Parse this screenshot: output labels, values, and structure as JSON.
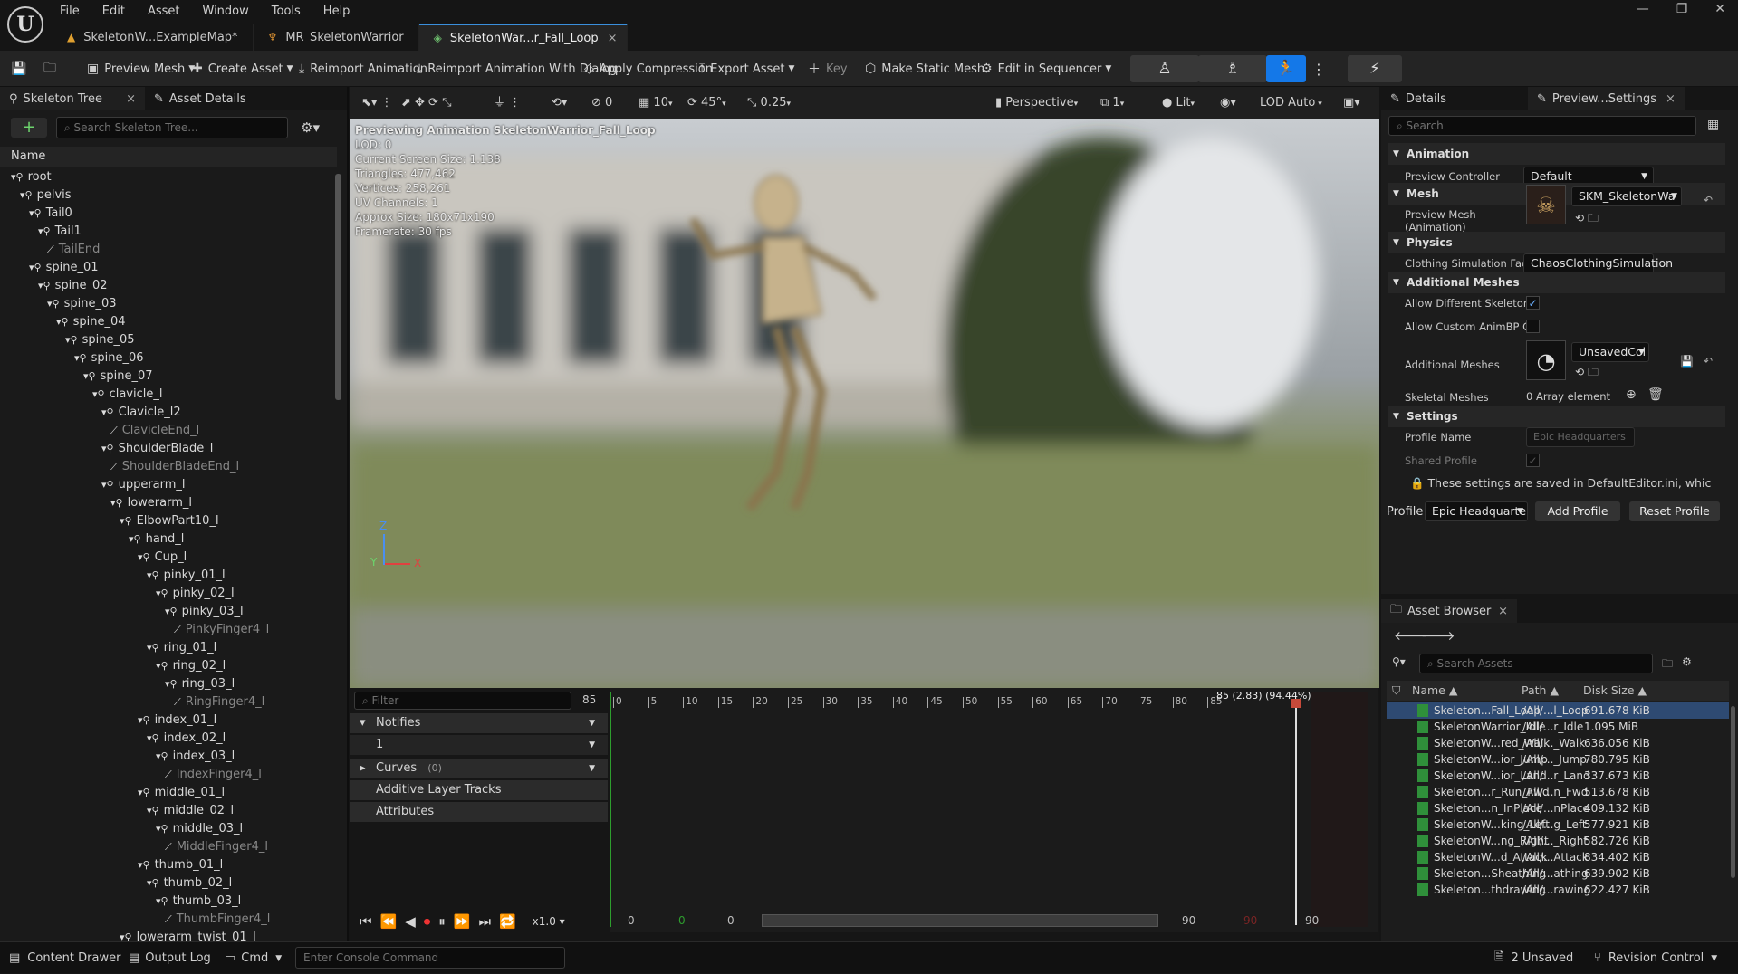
{
  "app": {
    "logo": "U"
  },
  "menu": [
    "File",
    "Edit",
    "Asset",
    "Window",
    "Tools",
    "Help"
  ],
  "doc_tabs": [
    {
      "label": "SkeletonW...ExampleMap*",
      "icon": "warning-icon"
    },
    {
      "label": "MR_SkeletonWarrior",
      "icon": "mesh-icon"
    },
    {
      "label": "SkeletonWar...r_Fall_Loop",
      "icon": "animation-icon",
      "close": "×"
    }
  ],
  "window_controls": [
    "—",
    "❐",
    "✕"
  ],
  "toolbar": {
    "preview_mesh": "Preview Mesh",
    "create_asset": "Create Asset",
    "reimport": "Reimport Animation",
    "reimport_dialog": "Reimport Animation With Dialog",
    "apply_compression": "Apply Compression",
    "export_asset": "Export Asset",
    "key": "Key",
    "make_static": "Make Static Mesh",
    "edit_sequencer": "Edit in Sequencer"
  },
  "skeleton_panel": {
    "tab": "Skeleton Tree",
    "tab2": "Asset Details",
    "close": "×",
    "search_placeholder": "Search Skeleton Tree...",
    "column": "Name",
    "add": "+",
    "bones": [
      {
        "n": "root",
        "d": 0
      },
      {
        "n": "pelvis",
        "d": 1
      },
      {
        "n": "Tail0",
        "d": 2
      },
      {
        "n": "Tail1",
        "d": 3
      },
      {
        "n": "TailEnd",
        "d": 4,
        "v": true
      },
      {
        "n": "spine_01",
        "d": 2
      },
      {
        "n": "spine_02",
        "d": 3
      },
      {
        "n": "spine_03",
        "d": 4
      },
      {
        "n": "spine_04",
        "d": 5
      },
      {
        "n": "spine_05",
        "d": 6
      },
      {
        "n": "spine_06",
        "d": 7
      },
      {
        "n": "spine_07",
        "d": 8
      },
      {
        "n": "clavicle_l",
        "d": 9
      },
      {
        "n": "Clavicle_l2",
        "d": 10
      },
      {
        "n": "ClavicleEnd_l",
        "d": 11,
        "v": true
      },
      {
        "n": "ShoulderBlade_l",
        "d": 10
      },
      {
        "n": "ShoulderBladeEnd_l",
        "d": 11,
        "v": true
      },
      {
        "n": "upperarm_l",
        "d": 10
      },
      {
        "n": "lowerarm_l",
        "d": 11
      },
      {
        "n": "ElbowPart10_l",
        "d": 12
      },
      {
        "n": "hand_l",
        "d": 13
      },
      {
        "n": "Cup_l",
        "d": 14
      },
      {
        "n": "pinky_01_l",
        "d": 15
      },
      {
        "n": "pinky_02_l",
        "d": 16
      },
      {
        "n": "pinky_03_l",
        "d": 17
      },
      {
        "n": "PinkyFinger4_l",
        "d": 18,
        "v": true
      },
      {
        "n": "ring_01_l",
        "d": 15
      },
      {
        "n": "ring_02_l",
        "d": 16
      },
      {
        "n": "ring_03_l",
        "d": 17
      },
      {
        "n": "RingFinger4_l",
        "d": 18,
        "v": true
      },
      {
        "n": "index_01_l",
        "d": 14
      },
      {
        "n": "index_02_l",
        "d": 15
      },
      {
        "n": "index_03_l",
        "d": 16
      },
      {
        "n": "IndexFinger4_l",
        "d": 17,
        "v": true
      },
      {
        "n": "middle_01_l",
        "d": 14
      },
      {
        "n": "middle_02_l",
        "d": 15
      },
      {
        "n": "middle_03_l",
        "d": 16
      },
      {
        "n": "MiddleFinger4_l",
        "d": 17,
        "v": true
      },
      {
        "n": "thumb_01_l",
        "d": 14
      },
      {
        "n": "thumb_02_l",
        "d": 15
      },
      {
        "n": "thumb_03_l",
        "d": 16
      },
      {
        "n": "ThumbFinger4_l",
        "d": 17,
        "v": true
      },
      {
        "n": "lowerarm_twist_01_l",
        "d": 12
      }
    ]
  },
  "viewport": {
    "snap_rot": "0",
    "grid": "10",
    "angle": "45°",
    "scale": "0.25",
    "perspective": "Perspective",
    "lod_count": "1",
    "lit": "Lit",
    "lod": "LOD Auto",
    "stats": [
      "Previewing Animation SkeletonWarrior_Fall_Loop",
      "LOD: 0",
      "Current Screen Size: 1.138",
      "Triangles: 477,462",
      "Vertices: 258,261",
      "UV Channels: 1",
      "Approx Size: 180x71x190",
      "Framerate: 30 fps"
    ],
    "axis": {
      "z": "Z",
      "y": "Y",
      "x": "X"
    }
  },
  "timeline": {
    "filter_placeholder": "Filter",
    "frame_count": "85",
    "notifies": "Notifies",
    "notify_track": "1",
    "curves": "Curves",
    "curves_count": "(0)",
    "additive": "Additive Layer Tracks",
    "attributes": "Attributes",
    "ticks": [
      "0",
      "5",
      "10",
      "15",
      "20",
      "25",
      "30",
      "35",
      "40",
      "45",
      "50",
      "55",
      "60",
      "65",
      "70",
      "75",
      "80",
      "85"
    ],
    "playhead_label": "85 (2.83) (94.44%)",
    "speed": "x1.0",
    "range": [
      "0",
      "0",
      "0",
      "90",
      "90",
      "90"
    ]
  },
  "details": {
    "tab": "Details",
    "tab2": "Preview...Settings",
    "close": "×",
    "search_placeholder": "Search",
    "animation": "Animation",
    "preview_controller_label": "Preview Controller",
    "preview_controller": "Default",
    "mesh": "Mesh",
    "preview_mesh_label": "Preview Mesh (Animation)",
    "preview_mesh": "SKM_SkeletonWa",
    "physics": "Physics",
    "clothing_label": "Clothing Simulation Fact",
    "clothing": "ChaosClothingSimulation",
    "additional": "Additional Meshes",
    "allow_diff": "Allow Different Skeleton",
    "allow_custom": "Allow Custom AnimBP C",
    "additional_meshes_label": "Additional Meshes",
    "additional_meshes": "UnsavedCol",
    "skeletal_meshes_label": "Skeletal Meshes",
    "skeletal_meshes": "0 Array element",
    "settings": "Settings",
    "profile_name_label": "Profile Name",
    "profile_name": "Epic Headquarters",
    "shared_profile_label": "Shared Profile",
    "note": "These settings are saved in DefaultEditor.ini, whic",
    "profile_label": "Profile",
    "profile": "Epic Headquarte",
    "add_profile": "Add Profile",
    "reset_profile": "Reset Profile"
  },
  "assets": {
    "tab": "Asset Browser",
    "close": "×",
    "search_placeholder": "Search Assets",
    "cols": {
      "name": "Name",
      "path": "Path",
      "size": "Disk Size"
    },
    "rows": [
      {
        "name": "Skeleton...Fall_Loop",
        "path": "/All/...l_Loop",
        "size": "691.678 KiB",
        "sel": true
      },
      {
        "name": "SkeletonWarrior_Idle",
        "path": "/All/...r_Idle",
        "size": "1.095 MiB"
      },
      {
        "name": "SkeletonW...red_Walk",
        "path": "/All/..._Walk",
        "size": "636.056 KiB"
      },
      {
        "name": "SkeletonW...ior_Jump",
        "path": "/All/..._Jump",
        "size": "780.795 KiB"
      },
      {
        "name": "SkeletonW...ior_Land",
        "path": "/All/...r_Land",
        "size": "337.673 KiB"
      },
      {
        "name": "Skeleton...r_Run_Fwd",
        "path": "/All/...n_Fwd",
        "size": "513.678 KiB"
      },
      {
        "name": "Skeleton...n_InPlace",
        "path": "/All/...nPlace",
        "size": "409.132 KiB"
      },
      {
        "name": "SkeletonW...king_Left",
        "path": "/All/...g_Left",
        "size": "577.921 KiB"
      },
      {
        "name": "SkeletonW...ng_Right",
        "path": "/All/..._Right",
        "size": "582.726 KiB"
      },
      {
        "name": "SkeletonW...d_Attack",
        "path": "/All/...Attack",
        "size": "834.402 KiB"
      },
      {
        "name": "Skeleton...Sheathing",
        "path": "/All/...athing",
        "size": "639.902 KiB"
      },
      {
        "name": "Skeleton...thdrawing",
        "path": "/All/...rawing",
        "size": "622.427 KiB"
      }
    ]
  },
  "status": {
    "content_drawer": "Content Drawer",
    "output_log": "Output Log",
    "cmd": "Cmd",
    "console_placeholder": "Enter Console Command",
    "unsaved": "2 Unsaved",
    "revision": "Revision Control"
  }
}
